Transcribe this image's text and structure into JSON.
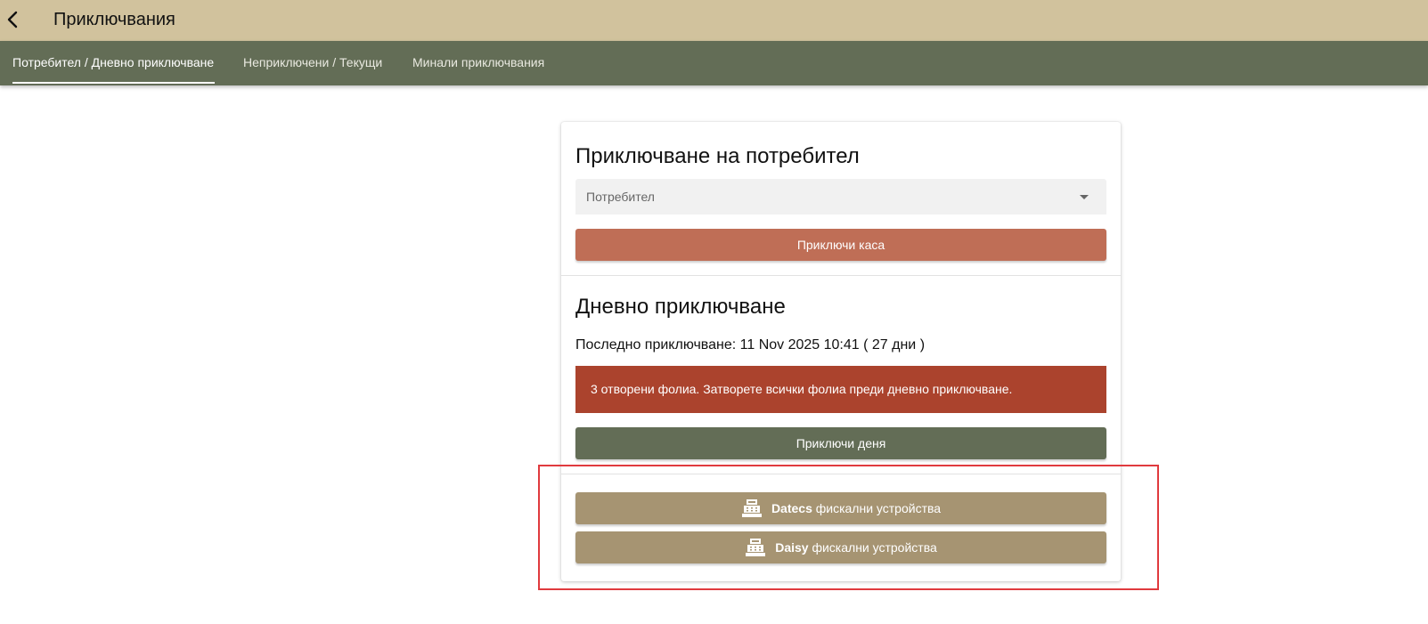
{
  "header": {
    "title": "Приключвания",
    "back_icon": "chevron-left-icon"
  },
  "tabs": [
    {
      "label": "Потребител / Дневно приключване",
      "active": true
    },
    {
      "label": "Неприключени / Текущи",
      "active": false
    },
    {
      "label": "Минали приключвания",
      "active": false
    }
  ],
  "user_close": {
    "title": "Приключване на потребител",
    "select_placeholder": "Потребител",
    "button_label": "Приключи каса"
  },
  "daily_close": {
    "title": "Дневно приключване",
    "last_close_label": "Последно приключване: 11 Nov 2025 10:41 ( 27 дни )",
    "alert_text": "3 отворени фолиа. Затворете всички фолиа преди дневно приключване.",
    "button_label": "Приключи деня"
  },
  "fiscal": {
    "icon": "cash-register-icon",
    "datecs_brand": "Datecs",
    "daisy_brand": "Daisy",
    "suffix": "фискални устройства"
  },
  "colors": {
    "header_bg": "#d1c29d",
    "tabbar_bg": "#636d56",
    "terracotta": "#bf6e56",
    "alert": "#ab432d",
    "olive": "#636d56",
    "khaki": "#a69472",
    "highlight": "#e03a3e"
  }
}
